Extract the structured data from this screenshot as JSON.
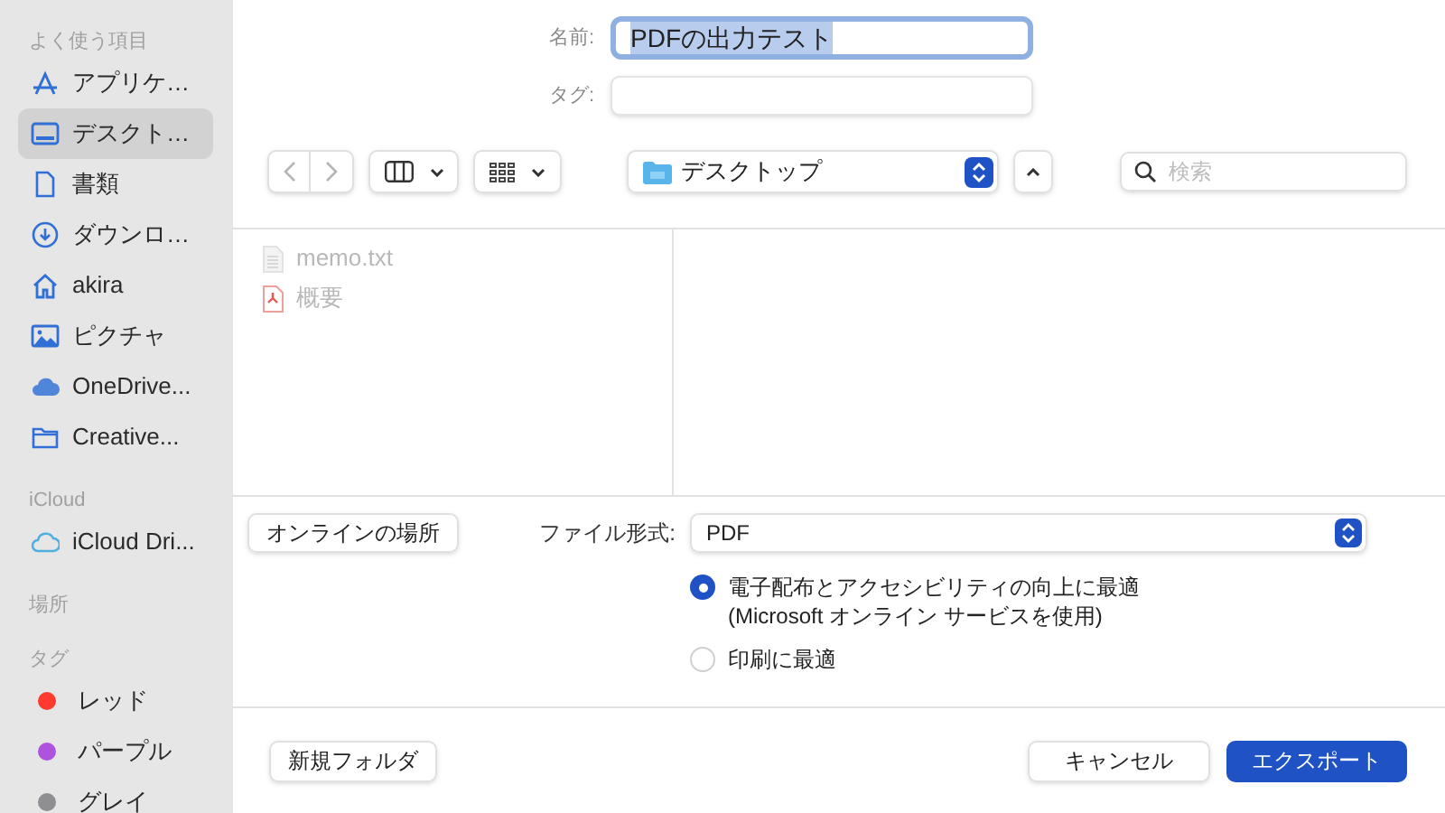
{
  "sidebar": {
    "sections": [
      {
        "title": "よく使う項目",
        "items": [
          {
            "label": "アプリケ…",
            "kind": "apps",
            "selected": false
          },
          {
            "label": "デスクト…",
            "kind": "desktop",
            "selected": true
          },
          {
            "label": "書類",
            "kind": "document",
            "selected": false
          },
          {
            "label": "ダウンロ…",
            "kind": "download",
            "selected": false
          },
          {
            "label": "akira",
            "kind": "home",
            "selected": false
          },
          {
            "label": "ピクチャ",
            "kind": "pictures",
            "selected": false
          },
          {
            "label": "OneDrive...",
            "kind": "cloud-filled",
            "selected": false
          },
          {
            "label": "Creative...",
            "kind": "folder",
            "selected": false
          }
        ]
      },
      {
        "title": "iCloud",
        "items": [
          {
            "label": "iCloud Dri...",
            "kind": "cloud",
            "selected": false
          }
        ]
      },
      {
        "title": "場所"
      },
      {
        "title": "タグ",
        "items": [
          {
            "label": "レッド",
            "kind": "tag",
            "color": "#ff3b30",
            "selected": false
          },
          {
            "label": "パープル",
            "kind": "tag",
            "color": "#af52de",
            "selected": false
          },
          {
            "label": "グレイ",
            "kind": "tag",
            "color": "#8e8e93",
            "selected": false
          }
        ]
      }
    ]
  },
  "name_field": {
    "label": "名前:",
    "value": "PDFの出力テスト"
  },
  "tags_field": {
    "label": "タグ:"
  },
  "location": {
    "value": "デスクトップ"
  },
  "search": {
    "placeholder": "検索"
  },
  "files": [
    {
      "name": "memo.txt",
      "kind": "text"
    },
    {
      "name": "概要",
      "kind": "pdf"
    }
  ],
  "online_button": "オンラインの場所",
  "format": {
    "label": "ファイル形式:",
    "value": "PDF"
  },
  "options": [
    {
      "label": "電子配布とアクセシビリティの向上に最適",
      "note": "(Microsoft オンライン サービスを使用)",
      "selected": true
    },
    {
      "label": "印刷に最適",
      "selected": false
    }
  ],
  "buttons": {
    "new_folder": "新規フォルダ",
    "cancel": "キャンセル",
    "export": "エクスポート"
  }
}
